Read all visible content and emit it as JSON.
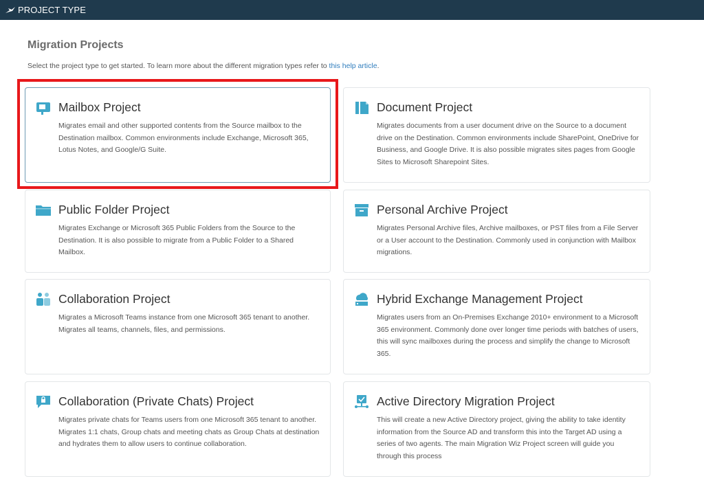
{
  "header": {
    "title": "PROJECT TYPE",
    "logo_icon": "bird-logo-icon"
  },
  "page": {
    "heading": "Migration Projects",
    "subtitle_text": "Select the project type to get started. To learn more about the different migration types refer to",
    "subtitle_link": "this help article",
    "subtitle_end": "."
  },
  "colors": {
    "header_bg": "#1f3a4d",
    "icon_accent": "#3fa7c9",
    "highlight": "#e8181b",
    "link": "#2f7dbd"
  },
  "projects": [
    {
      "title": "Mailbox Project",
      "icon": "mailbox-icon",
      "selected": true,
      "description": "Migrates email and other supported contents from the Source mailbox to the Destination mailbox. Common environments include Exchange, Microsoft 365, Lotus Notes, and Google/G Suite."
    },
    {
      "title": "Document Project",
      "icon": "document-icon",
      "description": "Migrates documents from a user document drive on the Source to a document drive on the Destination. Common environments include SharePoint, OneDrive for Business, and Google Drive. It is also possible migrates sites pages from Google Sites to Microsoft Sharepoint Sites."
    },
    {
      "title": "Public Folder Project",
      "icon": "folder-icon",
      "description": "Migrates Exchange or Microsoft 365 Public Folders from the Source to the Destination. It is also possible to migrate from a Public Folder to a Shared Mailbox."
    },
    {
      "title": "Personal Archive Project",
      "icon": "archive-icon",
      "description": "Migrates Personal Archive files, Archive mailboxes, or PST files from a File Server or a User account to the Destination. Commonly used in conjunction with Mailbox migrations."
    },
    {
      "title": "Collaboration Project",
      "icon": "users-icon",
      "description": "Migrates a Microsoft Teams instance from one Microsoft 365 tenant to another. Migrates all teams, channels, files, and permissions."
    },
    {
      "title": "Hybrid Exchange Management Project",
      "icon": "cloud-server-icon",
      "description": "Migrates users from an On-Premises Exchange 2010+ environment to a Microsoft 365 environment. Commonly done over longer time periods with batches of users, this will sync mailboxes during the process and simplify the change to Microsoft 365."
    },
    {
      "title": "Collaboration (Private Chats) Project",
      "icon": "private-chat-icon",
      "description": "Migrates private chats for Teams users from one Microsoft 365 tenant to another. Migrates 1:1 chats, Group chats and meeting chats as Group Chats at destination and hydrates them to allow users to continue collaboration."
    },
    {
      "title": "Active Directory Migration Project",
      "icon": "directory-network-icon",
      "description": "This will create a new Active Directory project, giving the ability to take identity information from the Source AD and transform this into the Target AD using a series of two agents. The main Migration Wiz Project screen will guide you through this process"
    }
  ]
}
